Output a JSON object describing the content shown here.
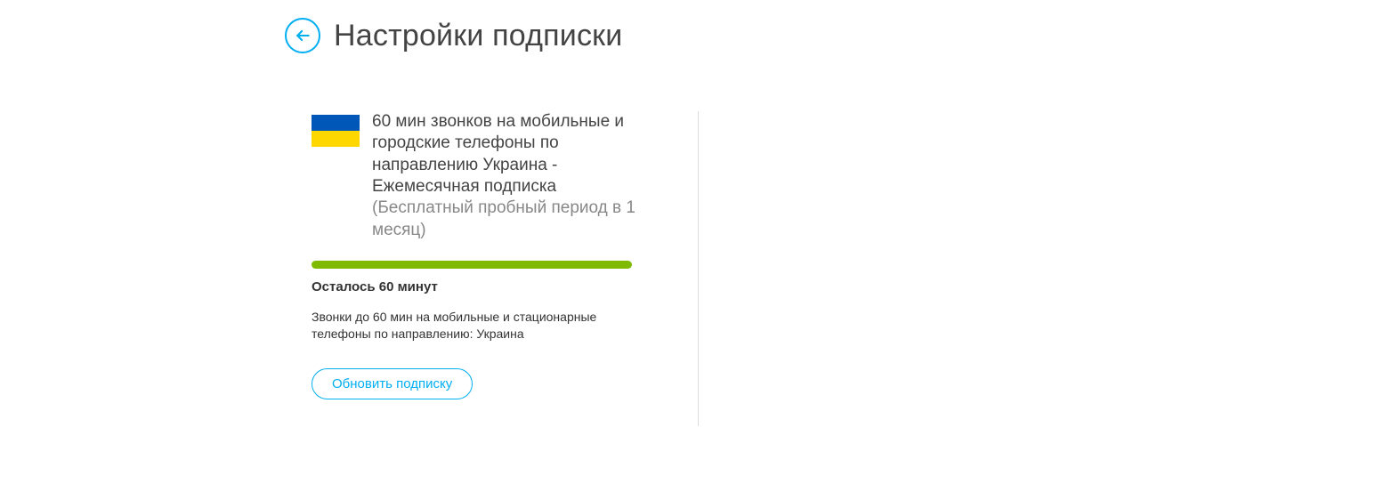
{
  "header": {
    "title": "Настройки подписки"
  },
  "plan": {
    "title_main": "60 мин звонков на мобильные и городские телефоны по направлению Украина - Ежемесячная подписка ",
    "title_sub": "(Бесплатный пробный период в 1 месяц)",
    "remaining": "Осталось 60 минут",
    "description": "Звонки до 60 мин на мобильные и стационарные телефоны по направлению: Украина",
    "update_label": "Обновить подписку",
    "flag": "ukraine",
    "progress_pct": 100
  },
  "colors": {
    "accent": "#00aff0",
    "progress": "#7fba00",
    "flag_top": "#0057b7",
    "flag_bottom": "#ffd700"
  }
}
